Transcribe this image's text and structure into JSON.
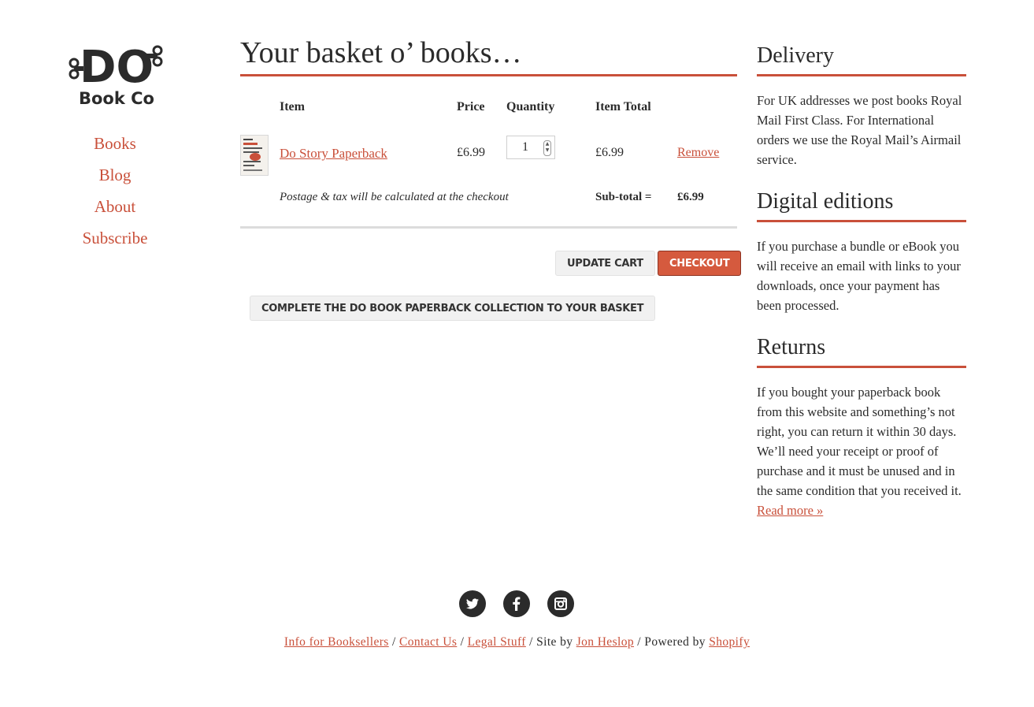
{
  "logo": {
    "text_top": "DO",
    "text_bottom": "Book Co"
  },
  "nav": {
    "items": [
      "Books",
      "Blog",
      "About",
      "Subscribe"
    ]
  },
  "cart": {
    "title": "Your basket o’ books…",
    "headers": {
      "item": "Item",
      "price": "Price",
      "quantity": "Quantity",
      "item_total": "Item Total"
    },
    "rows": [
      {
        "title": "Do Story Paperback",
        "price": "£6.99",
        "quantity": "1",
        "total": "£6.99",
        "remove": "Remove"
      }
    ],
    "note": "Postage & tax will be calculated at the checkout",
    "subtotal_label": "Sub-total =",
    "subtotal_value": "£6.99",
    "update_label": "Update cart",
    "checkout_label": "Checkout",
    "collection_label": "Complete the Do Book paperback collection to your basket"
  },
  "sidebar": {
    "delivery": {
      "title": "Delivery",
      "text": "For UK addresses we post books Royal Mail First Class. For International orders we use the Royal Mail’s Airmail service."
    },
    "digital": {
      "title": "Digital editions",
      "text": "If you purchase a bundle or eBook you will receive an email with links to your downloads, once your payment has been processed."
    },
    "returns": {
      "title": "Returns",
      "text": "If you bought your paperback book from this website and something’s not right, you can return it within 30 days. We’ll need your receipt or proof of purchase and it must be unused and in the same condition that you received it.",
      "read_more": "Read more »"
    }
  },
  "social": {
    "twitter": "twitter-icon",
    "facebook": "facebook-icon",
    "instagram": "instagram-icon"
  },
  "footer": {
    "booksellers": "Info for Booksellers",
    "sep": " / ",
    "contact": "Contact Us",
    "legal": "Legal Stuff",
    "site_by": "Site by",
    "author": "Jon Heslop",
    "powered_by": "Powered by",
    "shopify": "Shopify"
  },
  "colors": {
    "accent": "#c9503a",
    "button_accent": "#d55a3e",
    "text": "#2b2b2b"
  }
}
